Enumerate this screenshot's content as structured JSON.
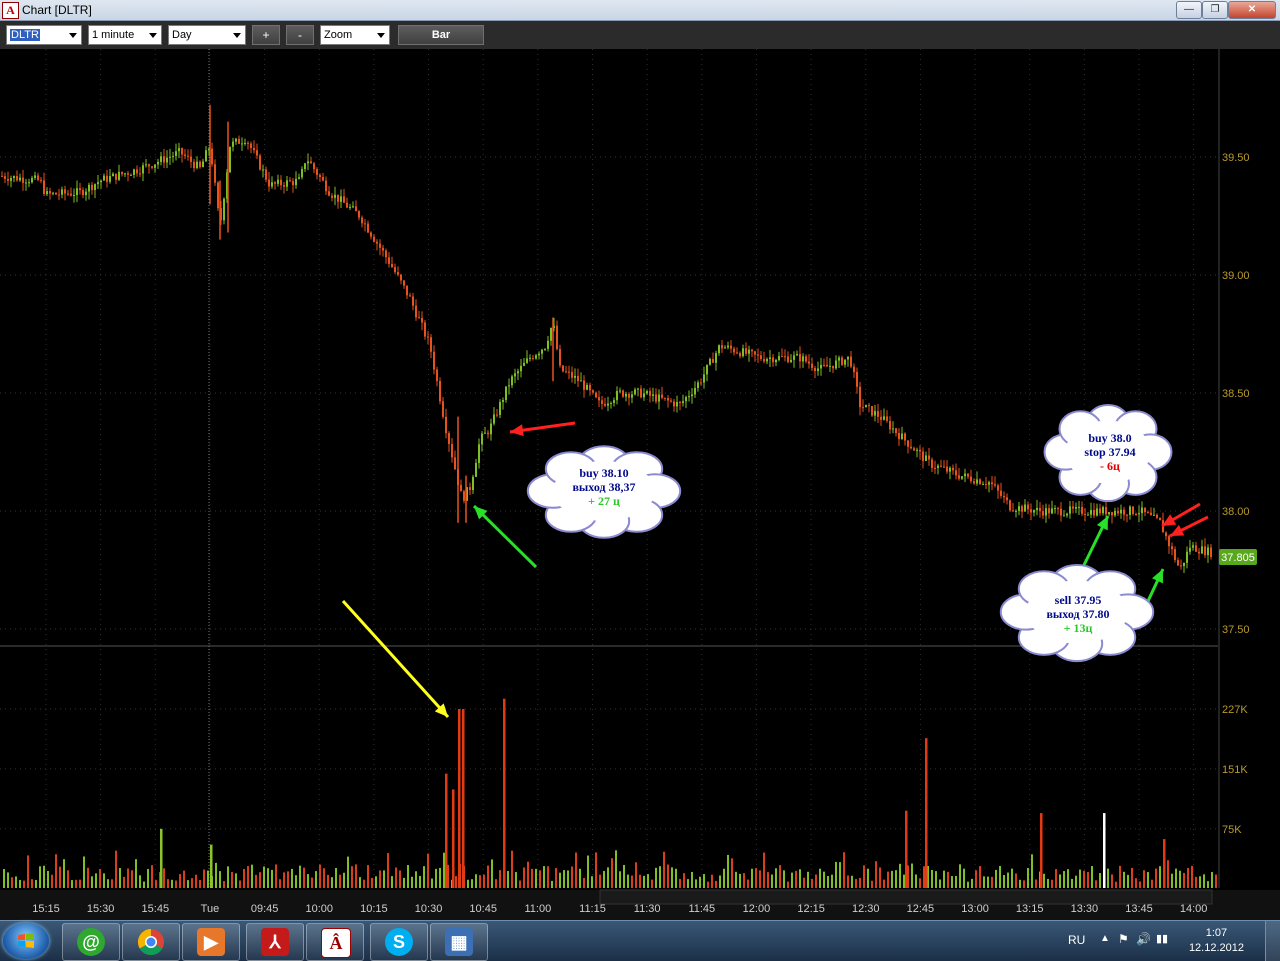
{
  "window": {
    "title": "Chart [DLTR]",
    "minimize": "—",
    "maximize": "❐",
    "close": "✕"
  },
  "toolbar": {
    "symbol": "DLTR",
    "interval": "1 minute",
    "period": "Day",
    "zoom_in": "+",
    "zoom_out": "-",
    "zoom_mode": "Zoom",
    "chart_type": "Bar"
  },
  "chart_data": {
    "type": "candlestick",
    "symbol": "DLTR",
    "price_ticks": [
      "39.50",
      "39.00",
      "38.50",
      "38.00",
      "37.50"
    ],
    "price_tick_values": [
      39.5,
      39.0,
      38.5,
      38.0,
      37.5
    ],
    "last_price": "37.805",
    "volume_ticks": [
      "227K",
      "151K",
      "75K"
    ],
    "volume_tick_values": [
      227000,
      151000,
      75000
    ],
    "time_ticks": [
      "15:15",
      "15:30",
      "15:45",
      "Tue",
      "09:45",
      "10:00",
      "10:15",
      "10:30",
      "10:45",
      "11:00",
      "11:15",
      "11:30",
      "11:45",
      "12:00",
      "12:15",
      "12:30",
      "12:45",
      "13:00",
      "13:15",
      "13:30",
      "13:45",
      "14:00"
    ],
    "price_path": [
      [
        0,
        39.42
      ],
      [
        40,
        39.4
      ],
      [
        46,
        39.34
      ],
      [
        80,
        39.35
      ],
      [
        100,
        39.4
      ],
      [
        140,
        39.45
      ],
      [
        180,
        39.52
      ],
      [
        200,
        39.45
      ],
      [
        210,
        39.55
      ],
      [
        220,
        39.2
      ],
      [
        230,
        39.55
      ],
      [
        246,
        39.58
      ],
      [
        270,
        39.38
      ],
      [
        300,
        39.4
      ],
      [
        306,
        39.5
      ],
      [
        330,
        39.35
      ],
      [
        360,
        39.25
      ],
      [
        390,
        39.05
      ],
      [
        410,
        38.9
      ],
      [
        430,
        38.7
      ],
      [
        446,
        38.35
      ],
      [
        462,
        38.05
      ],
      [
        470,
        38.1
      ],
      [
        480,
        38.3
      ],
      [
        490,
        38.35
      ],
      [
        510,
        38.55
      ],
      [
        530,
        38.65
      ],
      [
        545,
        38.7
      ],
      [
        553,
        38.8
      ],
      [
        560,
        38.6
      ],
      [
        580,
        38.55
      ],
      [
        600,
        38.45
      ],
      [
        620,
        38.5
      ],
      [
        640,
        38.5
      ],
      [
        680,
        38.45
      ],
      [
        700,
        38.55
      ],
      [
        720,
        38.7
      ],
      [
        760,
        38.65
      ],
      [
        800,
        38.65
      ],
      [
        820,
        38.6
      ],
      [
        850,
        38.65
      ],
      [
        860,
        38.45
      ],
      [
        880,
        38.4
      ],
      [
        905,
        38.3
      ],
      [
        930,
        38.2
      ],
      [
        960,
        38.15
      ],
      [
        990,
        38.12
      ],
      [
        1010,
        38.02
      ],
      [
        1040,
        38.0
      ],
      [
        1080,
        38.0
      ],
      [
        1110,
        38.0
      ],
      [
        1140,
        38.0
      ],
      [
        1160,
        37.95
      ],
      [
        1170,
        37.85
      ],
      [
        1180,
        37.75
      ],
      [
        1190,
        37.85
      ],
      [
        1215,
        37.82
      ]
    ],
    "volume_spikes": [
      [
        160,
        75000
      ],
      [
        210,
        55000
      ],
      [
        445,
        145000
      ],
      [
        452,
        125000
      ],
      [
        458,
        227000
      ],
      [
        462,
        227000
      ],
      [
        503,
        240000
      ],
      [
        905,
        98000
      ],
      [
        925,
        190000
      ],
      [
        1040,
        95000
      ],
      [
        1103,
        95000
      ],
      [
        1163,
        62000
      ]
    ],
    "annotations": [
      {
        "lines": [
          "buy 38.10",
          "выход 38,37",
          "+ 27 ц"
        ]
      },
      {
        "lines": [
          "buy 38.0",
          "stop 37.94",
          "- 6ц"
        ]
      },
      {
        "lines": [
          "sell 37.95",
          "выход  37.80",
          "+ 13ц"
        ]
      }
    ]
  },
  "taskbar": {
    "language": "RU",
    "time": "1:07",
    "date": "12.12.2012",
    "apps": [
      "mail-agent-icon",
      "chrome-icon",
      "media-player-icon",
      "acrobat-icon",
      "trading-app-icon",
      "skype-icon",
      "reader-icon"
    ]
  }
}
